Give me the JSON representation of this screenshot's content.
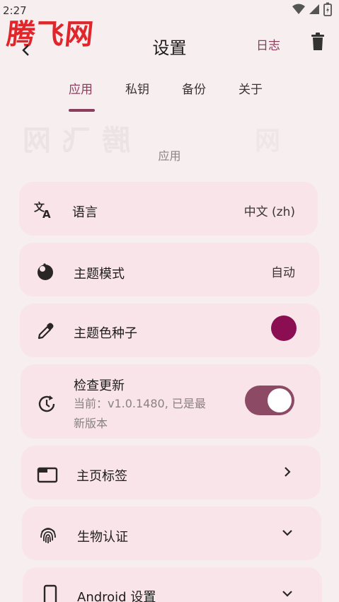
{
  "status": {
    "time": "2:27"
  },
  "watermark": {
    "logo_text": "腾飞网"
  },
  "header": {
    "title": "设置",
    "log_label": "日志"
  },
  "tabs": [
    {
      "label": "应用",
      "active": true
    },
    {
      "label": "私钥",
      "active": false
    },
    {
      "label": "备份",
      "active": false
    },
    {
      "label": "关于",
      "active": false
    }
  ],
  "section": {
    "title": "应用"
  },
  "settings": {
    "language": {
      "label": "语言",
      "value": "中文 (zh)",
      "icon": "translate-icon"
    },
    "theme_mode": {
      "label": "主题模式",
      "value": "自动",
      "icon": "theme-mode-icon"
    },
    "theme_seed": {
      "label": "主题色种子",
      "icon": "eyedropper-icon",
      "color": "#8b0d52"
    },
    "check_update": {
      "label": "检查更新",
      "sub_line1": "当前：v1.0.1480, 已是最",
      "sub_line2": "新版本",
      "icon": "update-icon",
      "enabled": true
    },
    "home_tabs": {
      "label": "主页标签",
      "icon": "tab-icon"
    },
    "biometric": {
      "label": "生物认证",
      "icon": "fingerprint-icon"
    },
    "android": {
      "label": "Android 设置",
      "icon": "phone-icon"
    }
  },
  "colors": {
    "accent": "#8c3d5e",
    "card": "#f9e5e9",
    "background": "#f6eeef",
    "toggle_track": "#8c4a64"
  }
}
